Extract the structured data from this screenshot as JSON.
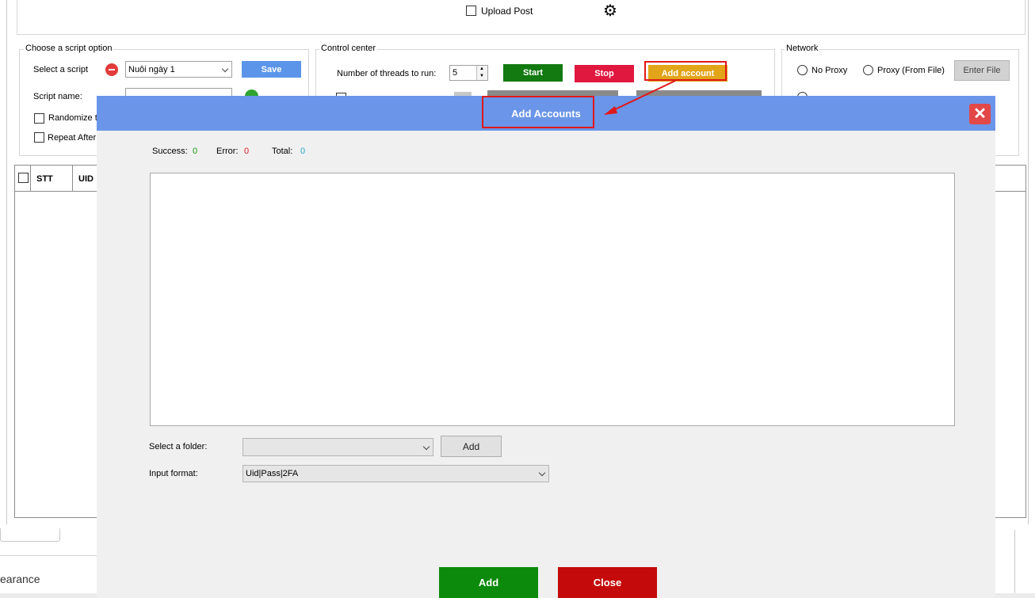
{
  "top": {
    "upload_post_label": "Upload Post"
  },
  "script_option": {
    "group_title": "Choose a script option",
    "select_label": "Select a script",
    "selected_script": "Nuôi ngày 1",
    "save_label": "Save",
    "script_name_label": "Script name:",
    "randomize_label": "Randomize th",
    "repeat_label": "Repeat After"
  },
  "control_center": {
    "group_title": "Control center",
    "threads_label": "Number of threads to run:",
    "threads_value": "5",
    "start_label": "Start",
    "stop_label": "Stop",
    "add_account_label": "Add account"
  },
  "network": {
    "group_title": "Network",
    "no_proxy_label": "No Proxy",
    "proxy_file_label": "Proxy (From File)",
    "enter_file_label": "Enter File"
  },
  "table": {
    "columns": [
      "STT",
      "UID"
    ]
  },
  "bottom": {
    "partial_text": "earance"
  },
  "dialog": {
    "title": "Add Accounts",
    "success_label": "Success:",
    "success_value": "0",
    "error_label": "Error:",
    "error_value": "0",
    "total_label": "Total:",
    "total_value": "0",
    "textarea_value": "",
    "folder_label": "Select a folder:",
    "folder_value": "",
    "folder_add_label": "Add",
    "format_label": "Input format:",
    "format_value": "Uid|Pass|2FA",
    "add_label": "Add",
    "close_label": "Close"
  },
  "colors": {
    "dialog_header": "#6a95e8",
    "start": "#137a11",
    "stop": "#e0173f",
    "add_account": "#e2a418",
    "save": "#5b95ea",
    "success": "#1a9a1a",
    "error": "#e02020",
    "total": "#2aa7c9",
    "add_button": "#0c8a0c",
    "close_button": "#c40a0a",
    "annotation": "#e01818"
  }
}
